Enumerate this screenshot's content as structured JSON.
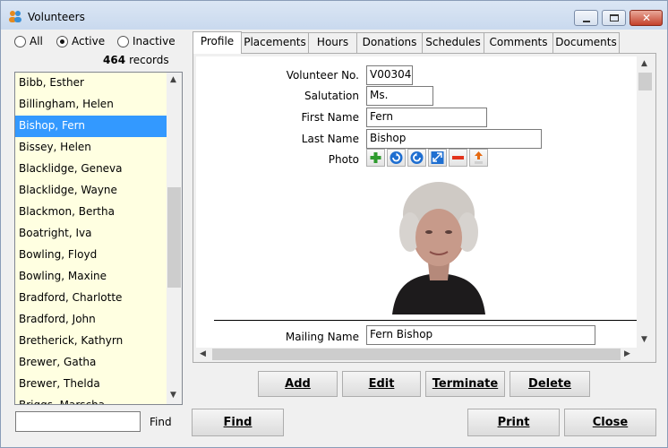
{
  "window": {
    "title": "Volunteers",
    "app_icon": "people-icon",
    "controls": [
      "minimize-icon",
      "maximize-icon",
      "close-icon"
    ]
  },
  "filter": {
    "all_label": "All",
    "active_label": "Active",
    "inactive_label": "Inactive",
    "selected": "Active"
  },
  "records": {
    "count": "464",
    "label": "records"
  },
  "list": {
    "items": [
      "Bibb, Esther",
      "Billingham, Helen",
      "Bishop, Fern",
      "Bissey, Helen",
      "Blacklidge, Geneva",
      "Blacklidge, Wayne",
      "Blackmon, Bertha",
      "Boatright, Iva",
      "Bowling, Floyd",
      "Bowling, Maxine",
      "Bradford, Charlotte",
      "Bradford, John",
      "Bretherick, Kathyrn",
      "Brewer, Gatha",
      "Brewer, Thelda",
      "Briggs, Marscha"
    ],
    "selected_index": 2
  },
  "find": {
    "value": "",
    "label": "Find"
  },
  "tabs": [
    "Profile",
    "Placements",
    "Hours",
    "Donations",
    "Schedules",
    "Comments",
    "Documents"
  ],
  "active_tab": "Profile",
  "profile": {
    "volunteer_no_label": "Volunteer No.",
    "volunteer_no": "V00304",
    "salutation_label": "Salutation",
    "salutation": "Ms.",
    "first_name_label": "First Name",
    "first_name": "Fern",
    "last_name_label": "Last Name",
    "last_name": "Bishop",
    "photo_label": "Photo",
    "photo_tools": [
      "add-icon",
      "rotate-left-icon",
      "rotate-right-icon",
      "expand-icon",
      "remove-icon",
      "upload-icon"
    ],
    "mailing_name_label": "Mailing Name",
    "mailing_name": "Fern Bishop"
  },
  "actions": {
    "add": "Add",
    "edit": "Edit",
    "terminate": "Terminate",
    "delete": "Delete"
  },
  "footer": {
    "find": "Find",
    "print": "Print",
    "close": "Close"
  }
}
